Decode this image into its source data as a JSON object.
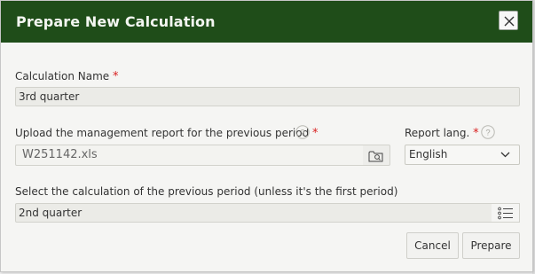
{
  "dialog": {
    "title": "Prepare New Calculation",
    "close_icon": "close-icon"
  },
  "calc_name": {
    "label": "Calculation Name",
    "required_mark": "*",
    "value": "3rd quarter"
  },
  "upload": {
    "label": "Upload the management report for the previous period",
    "required_mark": "*",
    "help_icon": "help-icon",
    "value": "W251142.xls",
    "browse_icon": "folder-search-icon"
  },
  "report_lang": {
    "label": "Report lang.",
    "required_mark": "*",
    "help_icon": "help-icon",
    "selected": "English",
    "dropdown_icon": "chevron-down-icon"
  },
  "previous_calc": {
    "label": "Select the calculation of the previous period (unless it's the first period)",
    "value": "2nd quarter",
    "list_icon": "list-icon"
  },
  "buttons": {
    "cancel": "Cancel",
    "prepare": "Prepare"
  },
  "colors": {
    "header_bg": "#1f4d19",
    "required": "#d81e1e"
  }
}
